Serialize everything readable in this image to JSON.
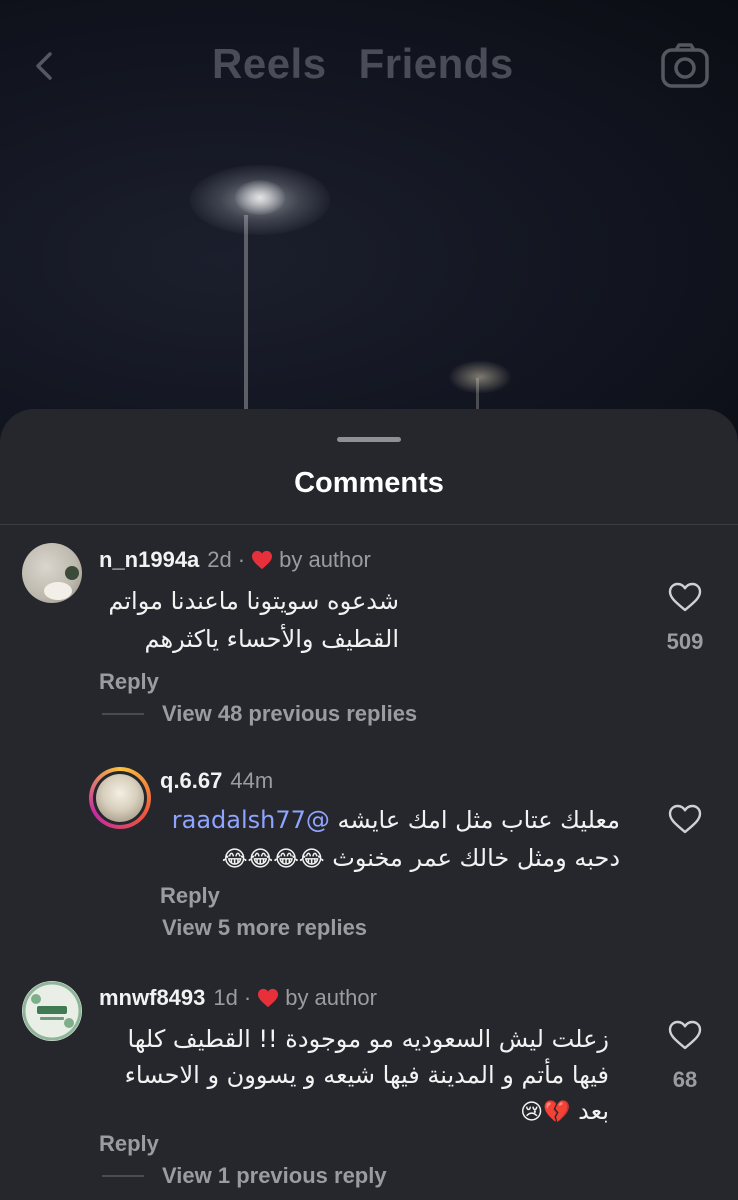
{
  "header": {
    "tabs": [
      "Reels",
      "Friends"
    ]
  },
  "sheet": {
    "title": "Comments"
  },
  "comments": [
    {
      "username": "n_n1994a",
      "time": "2d",
      "badge": "by author",
      "lines": [
        "شدعوه سويتونا ماعندنا مواتم",
        "القطيف والأحساء ياكثرهم"
      ],
      "likes": "509",
      "reply_label": "Reply",
      "view_replies": "View 48 previous replies"
    },
    {
      "username": "q.6.67",
      "time": "44m",
      "mention": "@raadalsh77",
      "line1_rest": "معليك عتاب مثل امك عايشه",
      "line2": "دحبه ومثل خالك عمر مخنوث",
      "emojis": "😂😂😂😂",
      "reply_label": "Reply",
      "view_replies": "View 5 more replies"
    },
    {
      "username": "mnwf8493",
      "time": "1d",
      "badge": "by author",
      "lines": [
        "زعلت ليش السعوديه مو موجودة !! القطيف كلها",
        "فيها مأتم و المدينة فيها شيعه و يسوون و الاحساء"
      ],
      "line3": "بعد",
      "emojis": "💔😢",
      "likes": "68",
      "reply_label": "Reply",
      "view_replies": "View 1 previous reply"
    }
  ],
  "colors": {
    "sheet_bg": "#25272c",
    "mention": "#8fa4ff",
    "author_heart": "#e8303a"
  }
}
